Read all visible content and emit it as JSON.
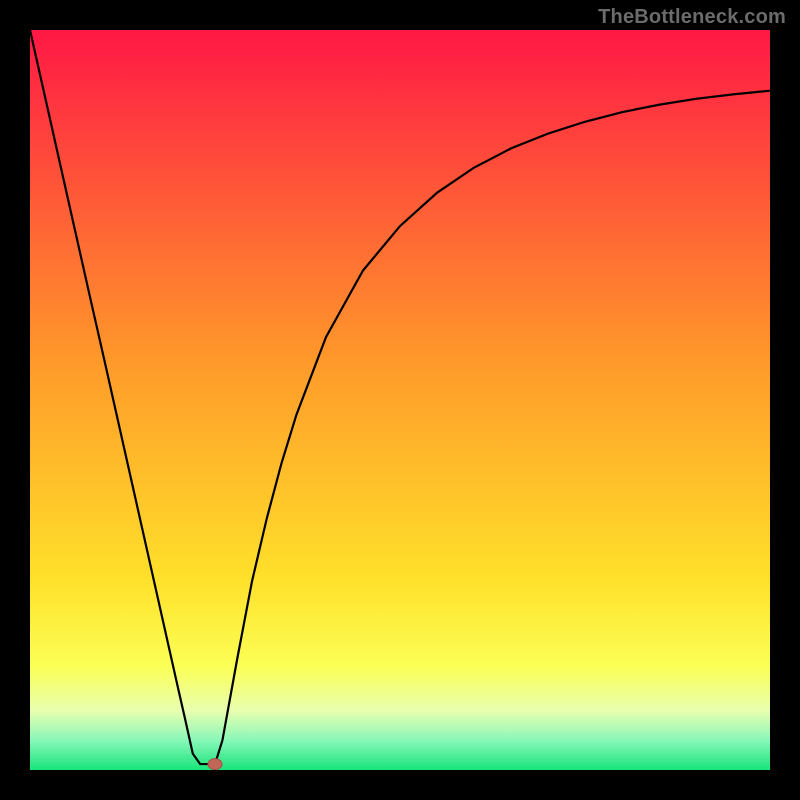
{
  "attribution": "TheBottleneck.com",
  "colors": {
    "frame": "#000000",
    "curve": "#000000",
    "marker_fill": "#c1675a",
    "marker_stroke": "#a84f44",
    "gradient_stops": [
      {
        "offset": 0.0,
        "color": "#ff1845"
      },
      {
        "offset": 0.45,
        "color": "#ff9a2a"
      },
      {
        "offset": 0.74,
        "color": "#ffe02a"
      },
      {
        "offset": 0.86,
        "color": "#fbff55"
      },
      {
        "offset": 0.92,
        "color": "#e8ffb0"
      },
      {
        "offset": 0.96,
        "color": "#88f7b8"
      },
      {
        "offset": 1.0,
        "color": "#17e57b"
      }
    ]
  },
  "chart_data": {
    "type": "line",
    "title": "",
    "xlabel": "",
    "ylabel": "",
    "xlim": [
      0,
      100
    ],
    "ylim": [
      0,
      100
    ],
    "x": [
      0,
      2,
      4,
      6,
      8,
      10,
      12,
      14,
      16,
      18,
      20,
      21,
      22,
      23,
      24,
      25,
      26,
      28,
      30,
      32,
      34,
      36,
      40,
      45,
      50,
      55,
      60,
      65,
      70,
      75,
      80,
      85,
      90,
      95,
      100
    ],
    "values": [
      100,
      91.1,
      82.2,
      73.3,
      64.4,
      55.6,
      46.7,
      37.8,
      28.9,
      20.0,
      11.1,
      6.7,
      2.2,
      0.8,
      0.8,
      0.8,
      4.0,
      15.0,
      25.5,
      34.0,
      41.5,
      48.0,
      58.5,
      67.5,
      73.5,
      78.0,
      81.4,
      84.0,
      86.0,
      87.6,
      88.9,
      89.9,
      90.7,
      91.3,
      91.8
    ],
    "marker": {
      "x": 25,
      "y": 0.8
    }
  }
}
